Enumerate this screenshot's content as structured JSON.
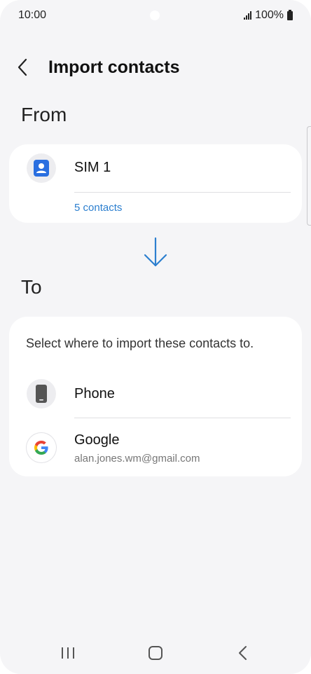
{
  "status_bar": {
    "time": "10:00",
    "battery": "100%",
    "icons": [
      "signal-icon",
      "battery-icon"
    ]
  },
  "header": {
    "title": "Import contacts",
    "back_icon": "chevron-left-icon"
  },
  "from_section": {
    "heading": "From",
    "source": {
      "name": "SIM 1",
      "icon": "contact-card-icon",
      "contacts_link": "5 contacts"
    }
  },
  "transfer_icon": "arrow-down-icon",
  "to_section": {
    "heading": "To",
    "description": "Select where to import these contacts to.",
    "options": [
      {
        "label": "Phone",
        "icon": "phone-device-icon"
      },
      {
        "label": "Google",
        "sublabel": "alan.jones.wm@gmail.com",
        "icon": "google-icon"
      }
    ]
  },
  "nav_bar": {
    "buttons": [
      "recent-apps-icon",
      "home-icon",
      "back-icon"
    ]
  },
  "colors": {
    "background": "#f5f5f7",
    "card": "#ffffff",
    "accent_blue": "#2c7fcf",
    "sim_icon_blue": "#2a6fe0"
  }
}
